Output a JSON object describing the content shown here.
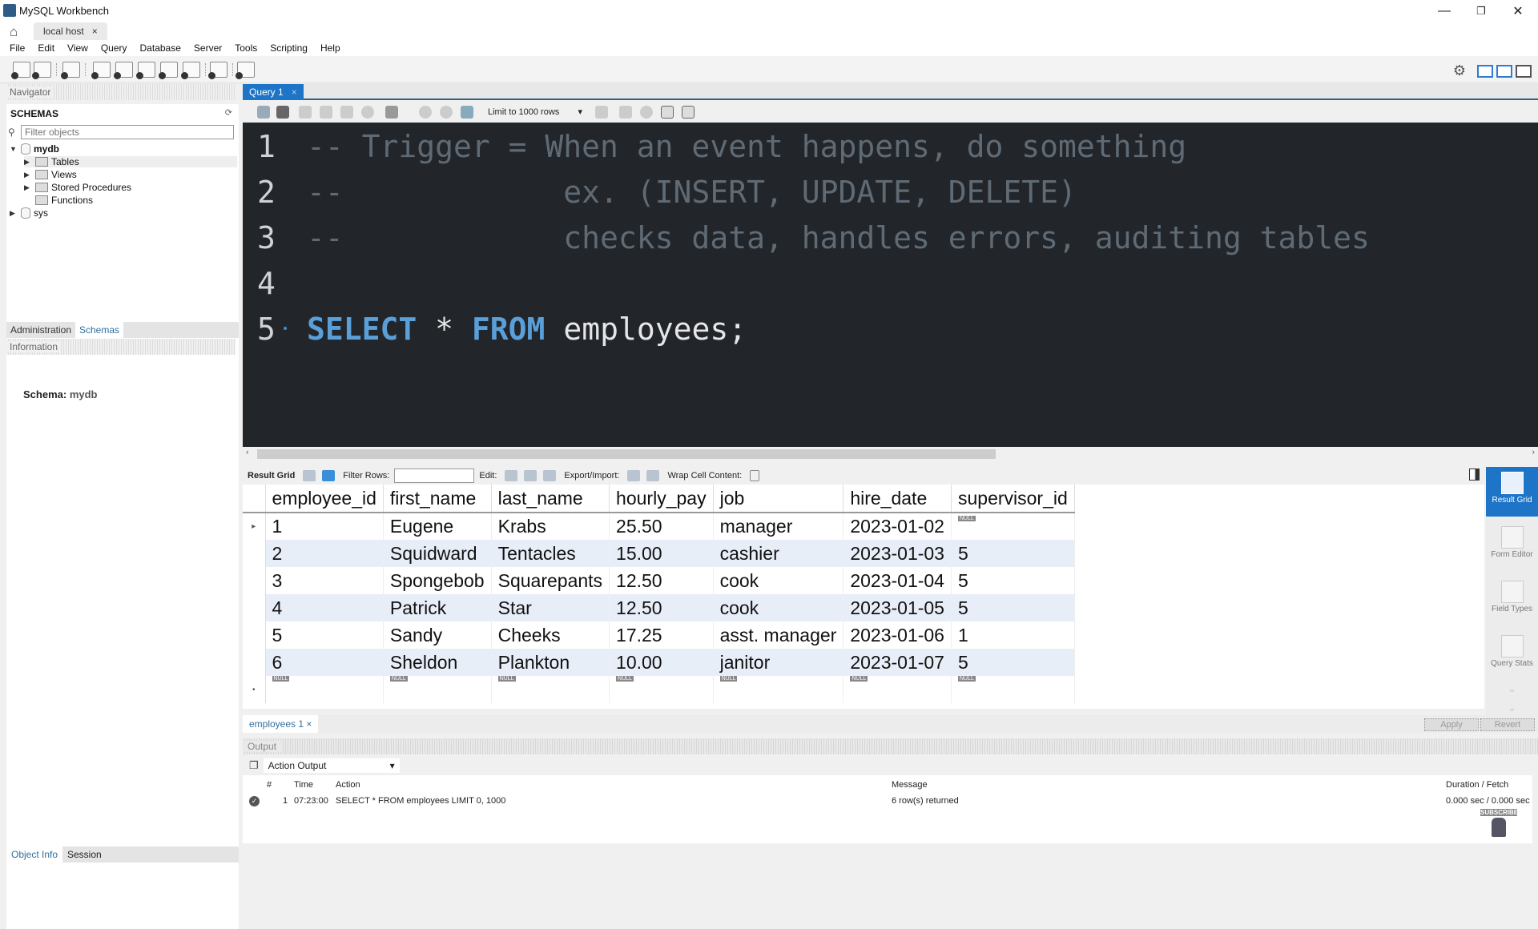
{
  "window": {
    "title": "MySQL Workbench",
    "minimize": "—",
    "restore": "❐",
    "close": "✕"
  },
  "connection_tab": {
    "label": "local host",
    "close": "×"
  },
  "menu": [
    "File",
    "Edit",
    "View",
    "Query",
    "Database",
    "Server",
    "Tools",
    "Scripting",
    "Help"
  ],
  "navigator": {
    "header": "Navigator",
    "schemas_title": "SCHEMAS",
    "filter_placeholder": "Filter objects",
    "tree": [
      {
        "label": "mydb",
        "expanded": true,
        "bold": true,
        "children": [
          "Tables",
          "Views",
          "Stored Procedures",
          "Functions"
        ]
      },
      {
        "label": "sys",
        "expanded": false
      }
    ],
    "tabs": [
      "Administration",
      "Schemas"
    ],
    "active_tab": "Schemas",
    "information_header": "Information",
    "schema_label": "Schema:",
    "schema_value": "mydb",
    "bottom_tabs": [
      "Object Info",
      "Session"
    ]
  },
  "query_tab": {
    "label": "Query 1",
    "close": "×"
  },
  "query_toolbar": {
    "limit": "Limit to 1000 rows"
  },
  "editor": {
    "lines": [
      {
        "n": "1",
        "comment": "-- Trigger = When an event happens, do something"
      },
      {
        "n": "2",
        "comment": "--            ex. (INSERT, UPDATE, DELETE)"
      },
      {
        "n": "3",
        "comment": "--            checks data, handles errors, auditing tables"
      },
      {
        "n": "4",
        "comment": ""
      },
      {
        "n": "5",
        "kw1": "SELECT",
        "star": " * ",
        "kw2": "FROM",
        "ident": " employees;"
      }
    ]
  },
  "result_toolbar": {
    "result_grid": "Result Grid",
    "filter_rows": "Filter Rows:",
    "edit": "Edit:",
    "export_import": "Export/Import:",
    "wrap": "Wrap Cell Content:"
  },
  "grid": {
    "columns": [
      "employee_id",
      "first_name",
      "last_name",
      "hourly_pay",
      "job",
      "hire_date",
      "supervisor_id"
    ],
    "rows": [
      [
        "1",
        "Eugene",
        "Krabs",
        "25.50",
        "manager",
        "2023-01-02",
        null
      ],
      [
        "2",
        "Squidward",
        "Tentacles",
        "15.00",
        "cashier",
        "2023-01-03",
        "5"
      ],
      [
        "3",
        "Spongebob",
        "Squarepants",
        "12.50",
        "cook",
        "2023-01-04",
        "5"
      ],
      [
        "4",
        "Patrick",
        "Star",
        "12.50",
        "cook",
        "2023-01-05",
        "5"
      ],
      [
        "5",
        "Sandy",
        "Cheeks",
        "17.25",
        "asst. manager",
        "2023-01-06",
        "1"
      ],
      [
        "6",
        "Sheldon",
        "Plankton",
        "10.00",
        "janitor",
        "2023-01-07",
        "5"
      ]
    ],
    "null_label": "NULL"
  },
  "side_panel": [
    {
      "label": "Result Grid",
      "active": true
    },
    {
      "label": "Form Editor"
    },
    {
      "label": "Field Types"
    },
    {
      "label": "Query Stats"
    }
  ],
  "result_tab": {
    "label": "employees 1",
    "close": "×"
  },
  "buttons": {
    "apply": "Apply",
    "revert": "Revert"
  },
  "output": {
    "header": "Output",
    "selector": "Action Output",
    "columns": [
      "#",
      "Time",
      "Action",
      "Message",
      "Duration / Fetch"
    ],
    "rows": [
      {
        "n": "1",
        "time": "07:23:00",
        "action": "SELECT * FROM employees LIMIT 0, 1000",
        "message": "6 row(s) returned",
        "duration": "0.000 sec / 0.000 sec"
      }
    ]
  },
  "overlay": {
    "subscribe": "SUBSCRIBE"
  }
}
